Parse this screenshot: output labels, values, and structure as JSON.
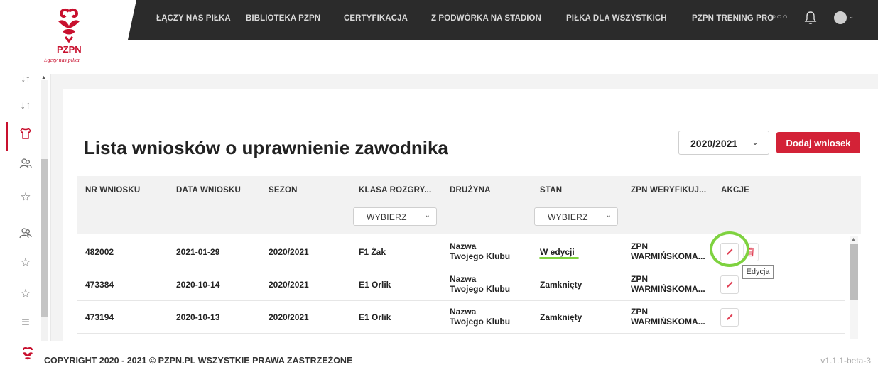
{
  "brand": {
    "name": "PZPN",
    "tagline": "Łączy nas piłka",
    "color": "#c8102e"
  },
  "nav": {
    "items": [
      "ŁĄCZY NAS PIŁKA",
      "BIBLIOTEKA PZPN",
      "CERTYFIKACJA",
      "Z PODWÓRKA NA STADION",
      "PIŁKA DLA WSZYSTKICH",
      "PZPN TRENING PRO"
    ],
    "more": "○○○"
  },
  "sidebar": {
    "icons": [
      "sort-icon",
      "shirt-icon",
      "people-icon",
      "star-icon",
      "people-icon",
      "star-icon",
      "star-icon",
      "menu-icon"
    ],
    "active_index": 1
  },
  "page": {
    "title": "Lista wniosków o uprawnienie zawodnika",
    "season_value": "2020/2021",
    "add_button": "Dodaj wniosek"
  },
  "table": {
    "headers": [
      "NR WNIOSKU",
      "DATA WNIOSKU",
      "SEZON",
      "KLASA ROZGRY...",
      "DRUŻYNA",
      "STAN",
      "ZPN WERYFIKUJ...",
      "AKCJE"
    ],
    "filter_placeholder_klasa": "WYBIERZ",
    "filter_placeholder_stan": "WYBIERZ",
    "rows": [
      {
        "nr": "482002",
        "data": "2021-01-29",
        "sezon": "2020/2021",
        "klasa": "F1 Żak",
        "druzyna1": "Nazwa",
        "druzyna2": "Twojego Klubu",
        "stan": "W edycji",
        "zpn1": "ZPN",
        "zpn2": "WARMIŃSKOMA..."
      },
      {
        "nr": "473384",
        "data": "2020-10-14",
        "sezon": "2020/2021",
        "klasa": "E1 Orlik",
        "druzyna1": "Nazwa",
        "druzyna2": "Twojego Klubu",
        "stan": "Zamknięty",
        "zpn1": "ZPN",
        "zpn2": "WARMIŃSKOMA..."
      },
      {
        "nr": "473194",
        "data": "2020-10-13",
        "sezon": "2020/2021",
        "klasa": "E1 Orlik",
        "druzyna1": "Nazwa",
        "druzyna2": "Twojego Klubu",
        "stan": "Zamknięty",
        "zpn1": "ZPN",
        "zpn2": "WARMIŃSKOMA..."
      }
    ],
    "tooltip": "Edycja"
  },
  "footer": {
    "copyright": "COPYRIGHT 2020 - 2021 © PZPN.PL WSZYSTKIE PRAWA ZASTRZEŻONE",
    "version": "v1.1.1-beta-3"
  },
  "colors": {
    "accent": "#d32237",
    "highlight": "#7ed23f",
    "nav_bg": "#2b2b2b"
  }
}
